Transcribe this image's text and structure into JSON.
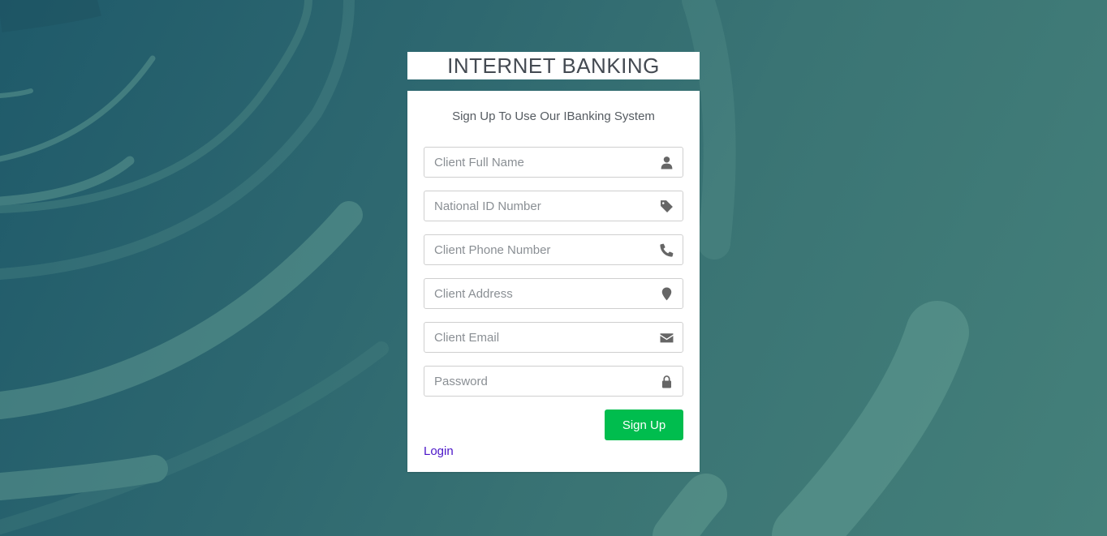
{
  "app": {
    "title": "INTERNET BANKING"
  },
  "form": {
    "message": "Sign Up To Use Our IBanking System",
    "fields": [
      {
        "placeholder": "Client Full Name",
        "value": "",
        "icon": "user-icon"
      },
      {
        "placeholder": "National ID Number",
        "value": "",
        "icon": "tag-icon"
      },
      {
        "placeholder": "Client Phone Number",
        "value": "",
        "icon": "phone-icon"
      },
      {
        "placeholder": "Client Address",
        "value": "",
        "icon": "map-marker-icon"
      },
      {
        "placeholder": "Client Email",
        "value": "",
        "icon": "envelope-icon"
      },
      {
        "placeholder": "Password",
        "value": "",
        "icon": "lock-icon"
      }
    ],
    "submit_label": "Sign Up",
    "login_label": "Login"
  },
  "colors": {
    "background": "#2e6870",
    "accent_button": "#00bd4e",
    "link": "#4a14c8"
  }
}
